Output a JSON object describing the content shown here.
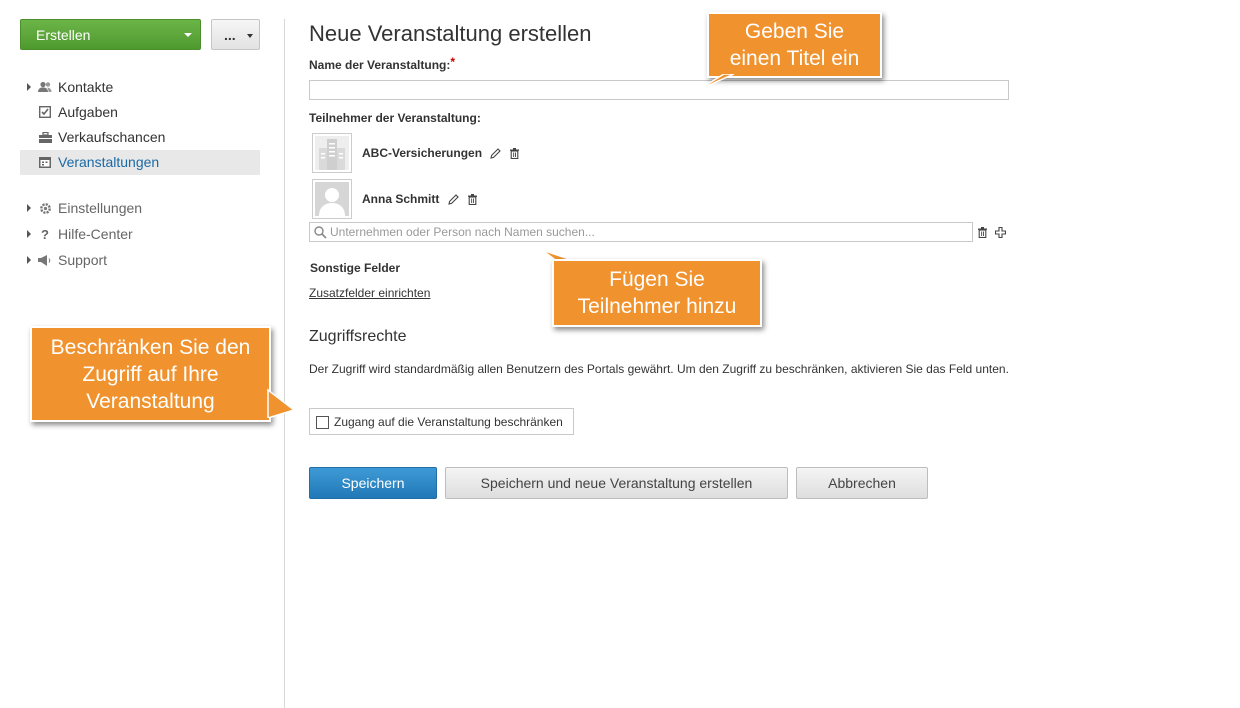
{
  "sidebar": {
    "create_label": "Erstellen",
    "more_label": "...",
    "nav_items": [
      {
        "label": "Kontakte"
      },
      {
        "label": "Aufgaben"
      },
      {
        "label": "Verkaufschancen"
      },
      {
        "label": "Veranstaltungen"
      },
      {
        "label": "Einstellungen"
      },
      {
        "label": "Hilfe-Center"
      },
      {
        "label": "Support"
      }
    ]
  },
  "form": {
    "page_title": "Neue Veranstaltung erstellen",
    "name_label": "Name der Veranstaltung:",
    "required_mark": "*",
    "name_value": "",
    "participants_label": "Teilnehmer der Veranstaltung:",
    "participants": [
      {
        "name": "ABC-Versicherungen"
      },
      {
        "name": "Anna Schmitt"
      }
    ],
    "search_placeholder": "Unternehmen oder Person nach Namen suchen...",
    "other_fields_label": "Sonstige Felder",
    "custom_fields_link": "Zusatzfelder einrichten",
    "access_heading": "Zugriffsrechte",
    "access_text": "Der Zugriff wird standardmäßig allen Benutzern des Portals gewährt. Um den Zugriff zu beschränken, aktivieren Sie das Feld unten.",
    "restrict_label": "Zugang auf die Veranstaltung beschränken",
    "restrict_checked": false,
    "save_label": "Speichern",
    "save_new_label": "Speichern und neue Veranstaltung erstellen",
    "cancel_label": "Abbrechen"
  },
  "callouts": {
    "title_hint": "Geben Sie einen Titel ein",
    "participants_hint": "Fügen Sie Teilnehmer hinzu",
    "access_hint": "Beschränken Sie den Zugriff auf Ihre Veranstaltung"
  },
  "colors": {
    "create_green": "#5aa63a",
    "save_blue": "#2a86c4",
    "active_link": "#1a6aa6",
    "callout_orange": "#f0922e",
    "required_red": "#cc0000"
  }
}
